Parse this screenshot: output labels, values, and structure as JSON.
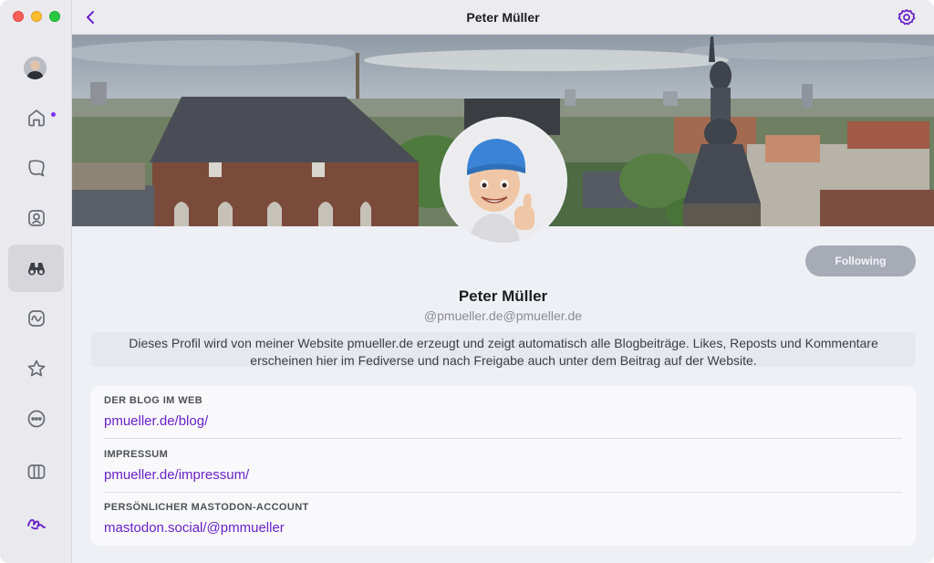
{
  "window": {
    "title": "Peter Müller"
  },
  "colors": {
    "accent": "#6a21c9",
    "follow_button_bg": "#a7abb6",
    "notification_dot": "#7b2ff7"
  },
  "sidebar": {
    "items": [
      {
        "icon": "home-icon",
        "active": false,
        "has_notification": true
      },
      {
        "icon": "mentions-bubble-icon",
        "active": false
      },
      {
        "icon": "profile-icon",
        "active": false
      },
      {
        "icon": "binoculars-icon",
        "active": true
      },
      {
        "icon": "activity-icon",
        "active": false
      },
      {
        "icon": "star-icon",
        "active": false
      },
      {
        "icon": "more-icon",
        "active": false
      },
      {
        "icon": "columns-icon",
        "active": false
      },
      {
        "icon": "app-logo-icon",
        "active": false
      }
    ]
  },
  "profile": {
    "name": "Peter Müller",
    "handle": "@pmueller.de@pmueller.de",
    "bio": "Dieses Profil wird von meiner Website pmueller.de erzeugt und zeigt automatisch alle Blogbeiträge. Likes, Reposts und Kommentare erscheinen hier im Fediverse und nach Freigabe auch unter dem Beitrag auf der Website.",
    "follow_label": "Following",
    "fields": [
      {
        "label": "DER BLOG IM WEB",
        "value": "pmueller.de/blog/"
      },
      {
        "label": "IMPRESSUM",
        "value": "pmueller.de/impressum/"
      },
      {
        "label": "PERSÖNLICHER MASTODON-ACCOUNT",
        "value": "mastodon.social/@pmmueller"
      }
    ]
  }
}
